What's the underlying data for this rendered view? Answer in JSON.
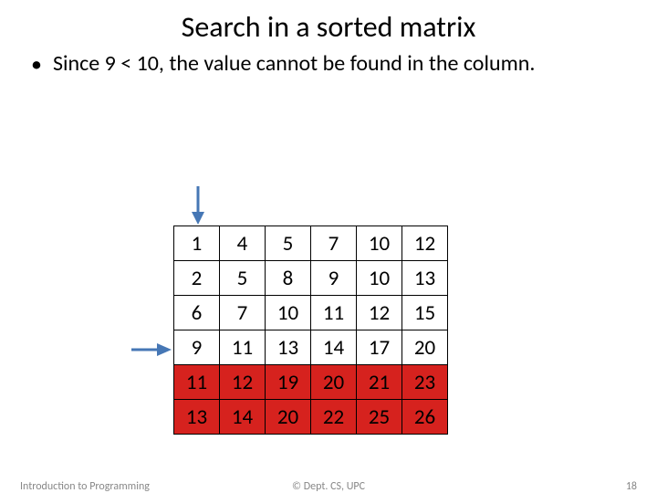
{
  "title": "Search in a sorted matrix",
  "bullet": "Since 9 < 10, the value cannot be found in the column.",
  "matrix": {
    "rows": [
      {
        "cells": [
          1,
          4,
          5,
          7,
          10,
          12
        ],
        "highlight": false
      },
      {
        "cells": [
          2,
          5,
          8,
          9,
          10,
          13
        ],
        "highlight": false
      },
      {
        "cells": [
          6,
          7,
          10,
          11,
          12,
          15
        ],
        "highlight": false
      },
      {
        "cells": [
          9,
          11,
          13,
          14,
          17,
          20
        ],
        "highlight": false
      },
      {
        "cells": [
          11,
          12,
          19,
          20,
          21,
          23
        ],
        "highlight": true
      },
      {
        "cells": [
          13,
          14,
          20,
          22,
          25,
          26
        ],
        "highlight": true
      }
    ],
    "pointer_col": 0,
    "pointer_row": 3
  },
  "arrow_color": "#4677b5",
  "footer": {
    "left": "Introduction to Programming",
    "center": "© Dept. CS, UPC",
    "right": "18"
  }
}
